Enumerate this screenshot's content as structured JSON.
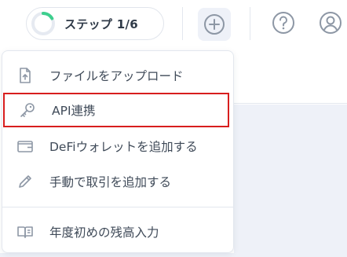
{
  "header": {
    "step_label": "ステップ 1/6",
    "step_progress": 0.1667,
    "accent_color": "#3ecf8e",
    "icons": [
      "plus-circle-icon",
      "help-circle-icon",
      "user-circle-icon"
    ]
  },
  "menu": {
    "items": [
      {
        "label": "ファイルをアップロード",
        "icon": "upload-file-icon"
      },
      {
        "label": "API連携",
        "icon": "key-icon",
        "highlighted": true
      },
      {
        "label": "DeFiウォレットを追加する",
        "icon": "wallet-icon"
      },
      {
        "label": "手動で取引を追加する",
        "icon": "pencil-icon"
      },
      {
        "label": "年度初めの残高入力",
        "icon": "book-icon"
      }
    ]
  },
  "colors": {
    "highlight_border": "#d81e1e",
    "icon_gray": "#8d97a5",
    "text": "#3f4a58"
  }
}
